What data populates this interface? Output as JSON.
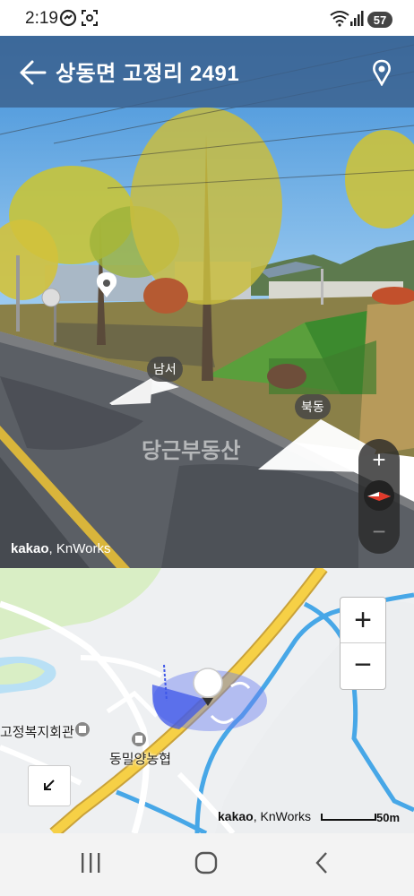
{
  "status_bar": {
    "time": "2:19",
    "battery": "57"
  },
  "header": {
    "title": "상동면 고정리 2491"
  },
  "street_view": {
    "direction_left": "남서",
    "direction_right": "북동",
    "watermark": "당근부동산",
    "credit_brand": "kakao",
    "credit_owner": ", KnWorks",
    "zoom_in": "+",
    "zoom_out": "−"
  },
  "map": {
    "poi_1": "고정복지회관",
    "poi_2": "동밀양농협",
    "zoom_in": "+",
    "zoom_out": "−",
    "credit_brand": "kakao",
    "credit_owner": ", KnWorks",
    "scale": "50m"
  },
  "colors": {
    "header": "#3c608c",
    "road": "#f7d54a",
    "water": "#4aa9e6"
  }
}
